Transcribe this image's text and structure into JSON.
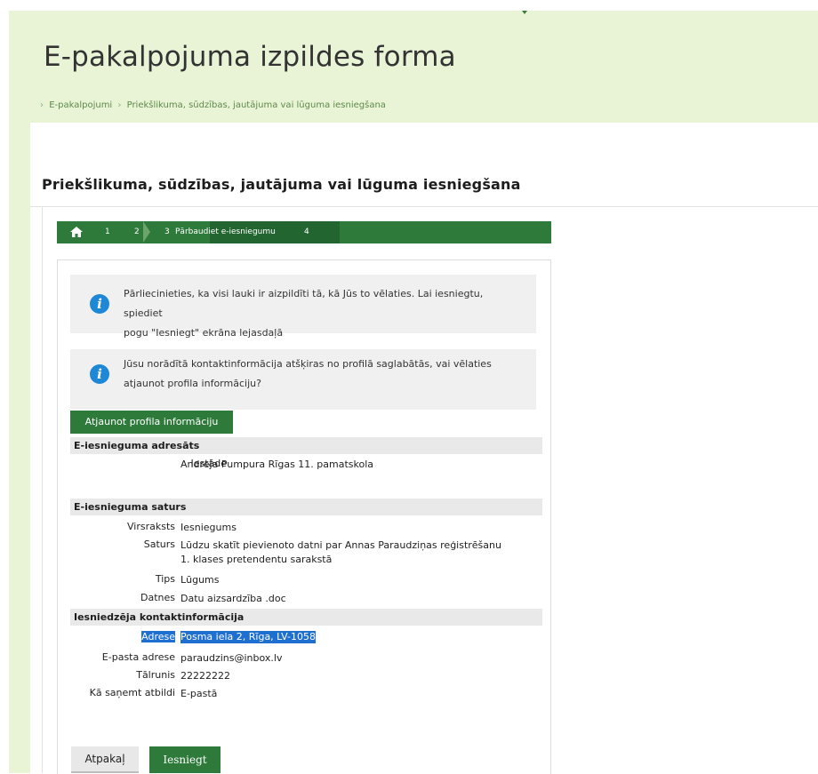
{
  "page": {
    "title": "E-pakalpojuma izpildes forma",
    "breadcrumb": [
      "E-pakalpojumi",
      "Priekšlikuma, sūdzības, jautājuma vai lūguma iesniegšana"
    ],
    "section_title": "Priekšlikuma, sūdzības, jautājuma vai lūguma iesniegšana"
  },
  "steps": {
    "home_icon": "home-icon",
    "items": [
      "1",
      "2",
      "3",
      "Pārbaudiet e-iesniegumu",
      "4"
    ],
    "active_step": "3"
  },
  "info1": {
    "icon": "info-icon",
    "line1": "Pārliecinieties, ka visi lauki ir aizpildīti tā, kā Jūs to vēlaties. Lai iesniegtu, spiediet",
    "line2": "pogu \"Iesniegt\" ekrāna lejasdaļā"
  },
  "info2": {
    "icon": "info-icon",
    "line1": "Jūsu norādītā kontaktinformācija atšķiras no profilā saglabātās, vai vēlaties",
    "line2": "atjaunot profila informāciju?"
  },
  "buttons": {
    "update_profile": "Atjaunot profila informāciju",
    "back": "Atpakaļ",
    "submit": "Iesniegt"
  },
  "recipient": {
    "heading": "E-iesnieguma adresāts",
    "institution_label": "Iestāde",
    "institution_value": "Andreja Pumpura Rīgas 11. pamatskola"
  },
  "content": {
    "heading": "E-iesnieguma saturs",
    "subject_label": "Virsraksts",
    "subject_value": "Iesniegums",
    "body_label": "Saturs",
    "body_line1": "Lūdzu skatīt pievienoto datni par Annas Paraudziņas reģistrēšanu",
    "body_line2": "1. klases pretendentu sarakstā",
    "type_label": "Tips",
    "type_value": "Lūgums",
    "files_label": "Datnes",
    "files_value": "Datu aizsardzība .doc"
  },
  "contact": {
    "heading": "Iesniedzēja kontaktinformācija",
    "address_label": "Adrese",
    "address_value": "Posma iela 2, Rīga, LV-1058",
    "email_label": "E-pasta adrese",
    "email_value": "paraudzins@inbox.lv",
    "phone_label": "Tālrunis",
    "phone_value": "22222222",
    "reply_label": "Kā saņemt atbildi",
    "reply_value": "E-pastā"
  },
  "colors": {
    "brand_green": "#2d7a3a",
    "header_band": "#e9f3d5",
    "info_blue": "#1e88d6",
    "selection": "#1e6fd0"
  }
}
